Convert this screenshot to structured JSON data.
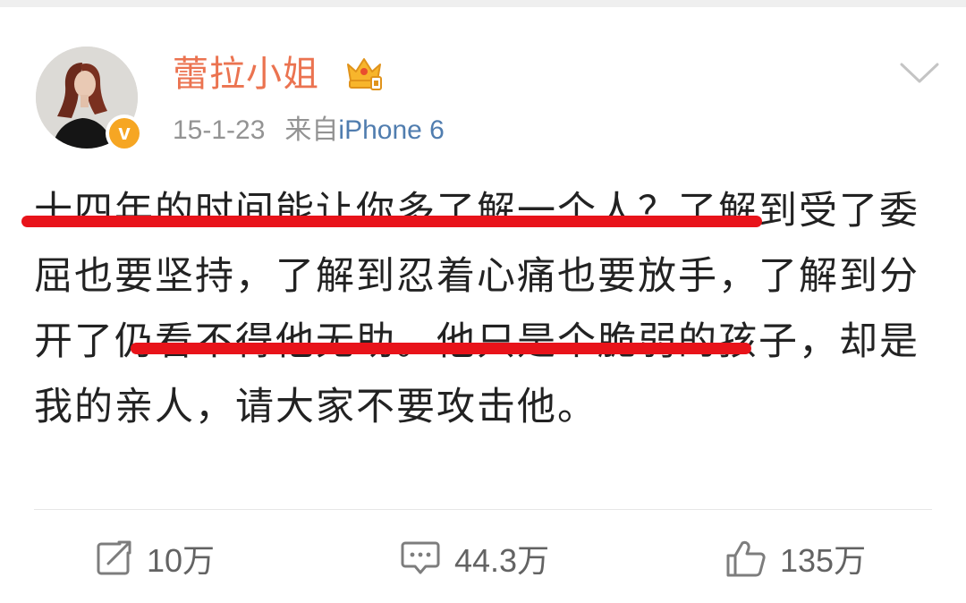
{
  "user": {
    "name": "蕾拉小姐",
    "verified_badge": "v",
    "avatar_icon": "avatar-photo",
    "vip_icon": "crown-icon"
  },
  "meta": {
    "time": "15-1-23",
    "source_prefix": "来自",
    "source": "iPhone 6"
  },
  "post": {
    "text": "十四年的时间能让你多了解一个人？了解到受了委屈也要坚持，了解到忍着心痛也要放手，了解到分开了仍看不得他无助。他只是个脆弱的孩子，却是我的亲人，请大家不要攻击他。"
  },
  "actions": {
    "repost": {
      "icon": "repost-icon",
      "count": "10万"
    },
    "comment": {
      "icon": "comment-icon",
      "count": "44.3万"
    },
    "like": {
      "icon": "like-icon",
      "count": "135万"
    }
  },
  "colors": {
    "username": "#eb7350",
    "source_link": "#507daf",
    "underline": "#e8131a",
    "badge": "#f6a623"
  }
}
